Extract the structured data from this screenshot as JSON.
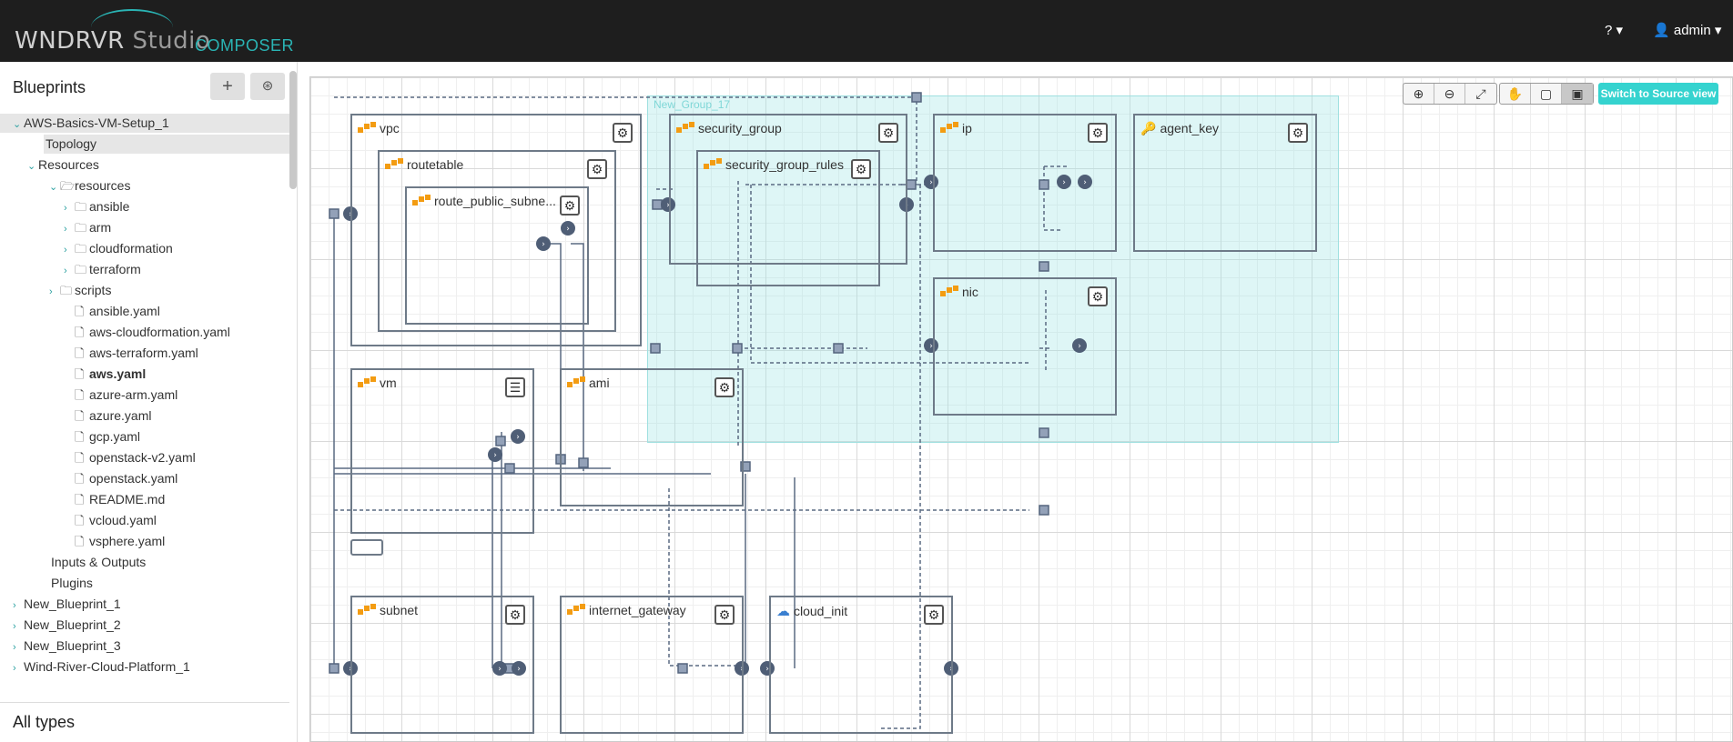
{
  "header": {
    "logo_main": "WNDRVR",
    "logo_studio": " Studio",
    "composer": "COMPOSER",
    "help_label": "? ▾",
    "user_label": "admin ▾",
    "user_icon": "user-icon"
  },
  "sidebar": {
    "title": "Blueprints",
    "add_button_icon": "plus-icon",
    "upload_button_icon": "arrow-right-circle-icon",
    "tree": [
      {
        "label": "AWS-Basics-VM-Setup_1",
        "chev": "⌄",
        "icon": "",
        "selected": true
      },
      {
        "label": "Topology",
        "chev": "",
        "icon": "",
        "selected": true
      },
      {
        "label": "Resources",
        "chev": "⌄",
        "icon": ""
      },
      {
        "label": "resources",
        "chev": "⌄",
        "icon": "folder-open-icon"
      },
      {
        "label": "ansible",
        "chev": "›",
        "icon": "folder-icon"
      },
      {
        "label": "arm",
        "chev": "›",
        "icon": "folder-icon"
      },
      {
        "label": "cloudformation",
        "chev": "›",
        "icon": "folder-icon"
      },
      {
        "label": "terraform",
        "chev": "›",
        "icon": "folder-icon"
      },
      {
        "label": "scripts",
        "chev": "›",
        "icon": "folder-icon"
      },
      {
        "label": "ansible.yaml",
        "chev": "",
        "icon": "file-icon"
      },
      {
        "label": "aws-cloudformation.yaml",
        "chev": "",
        "icon": "file-icon"
      },
      {
        "label": "aws-terraform.yaml",
        "chev": "",
        "icon": "file-icon"
      },
      {
        "label": "aws.yaml",
        "chev": "",
        "icon": "file-icon",
        "bold": true
      },
      {
        "label": "azure-arm.yaml",
        "chev": "",
        "icon": "file-icon"
      },
      {
        "label": "azure.yaml",
        "chev": "",
        "icon": "file-icon"
      },
      {
        "label": "gcp.yaml",
        "chev": "",
        "icon": "file-icon"
      },
      {
        "label": "openstack-v2.yaml",
        "chev": "",
        "icon": "file-icon"
      },
      {
        "label": "openstack.yaml",
        "chev": "",
        "icon": "file-icon"
      },
      {
        "label": "README.md",
        "chev": "",
        "icon": "file-icon"
      },
      {
        "label": "vcloud.yaml",
        "chev": "",
        "icon": "file-icon"
      },
      {
        "label": "vsphere.yaml",
        "chev": "",
        "icon": "file-icon"
      },
      {
        "label": "Inputs & Outputs",
        "chev": "",
        "icon": ""
      },
      {
        "label": "Plugins",
        "chev": "",
        "icon": ""
      },
      {
        "label": "New_Blueprint_1",
        "chev": "›",
        "icon": ""
      },
      {
        "label": "New_Blueprint_2",
        "chev": "›",
        "icon": ""
      },
      {
        "label": "New_Blueprint_3",
        "chev": "›",
        "icon": ""
      },
      {
        "label": "Wind-River-Cloud-Platform_1",
        "chev": "›",
        "icon": ""
      }
    ],
    "all_types_title": "All types"
  },
  "canvas": {
    "group_label": "New_Group_17",
    "switch_button": "Switch to Source view",
    "toolbar_zoom": [
      "zoom-in-icon",
      "zoom-out-icon",
      "fit-icon"
    ],
    "toolbar_mode": [
      "pan-hand-icon",
      "select-icon",
      "group-select-icon"
    ],
    "nodes": {
      "vpc": "vpc",
      "routetable": "routetable",
      "route_public_subnet": "route_public_subne...",
      "security_group": "security_group",
      "security_group_rules": "security_group_rules",
      "ip": "ip",
      "agent_key": "agent_key",
      "nic": "nic",
      "vm": "vm",
      "ami": "ami",
      "subnet": "subnet",
      "internet_gateway": "internet_gateway",
      "cloud_init": "cloud_init"
    }
  }
}
